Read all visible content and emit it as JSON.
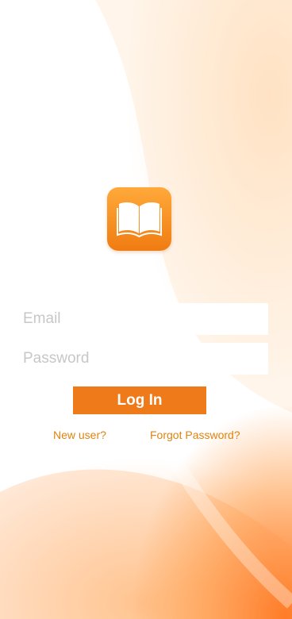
{
  "app": {
    "logo_icon": "open-book-icon"
  },
  "form": {
    "email_placeholder": "Email",
    "password_placeholder": "Password",
    "login_label": "Log In",
    "new_user_label": "New user?",
    "forgot_password_label": "Forgot Password?"
  },
  "colors": {
    "accent": "#ee7a1a",
    "link": "#e0830f",
    "logo_top": "#ffa93a",
    "logo_bottom": "#f07c12"
  }
}
